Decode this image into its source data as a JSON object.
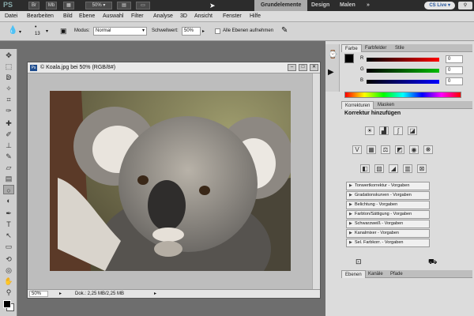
{
  "app": {
    "logo": "PS",
    "zoom_select": "50%",
    "workspaces": [
      "Grundelemente",
      "Design",
      "Malen"
    ],
    "more": "»",
    "cslive": "CS Live ▾"
  },
  "menu": [
    "Datei",
    "Bearbeiten",
    "Bild",
    "Ebene",
    "Auswahl",
    "Filter",
    "Analyse",
    "3D",
    "Ansicht",
    "Fenster",
    "Hilfe"
  ],
  "options": {
    "size": "13",
    "modus_label": "Modus:",
    "modus_value": "Normal",
    "schwell_label": "Schwellwert:",
    "schwell_value": "50%",
    "alle_label": "Alle Ebenen aufnehmen"
  },
  "document": {
    "title": "© Koala.jpg bei 50% (RGB/8#)",
    "zoom": "50%",
    "info": "Dok.: 2,25 MB/2,25 MB"
  },
  "color_panel": {
    "tabs": [
      "Farbe",
      "Farbfelder",
      "Stile"
    ],
    "sliders": [
      {
        "label": "R",
        "value": "0",
        "color": "#d82020"
      },
      {
        "label": "G",
        "value": "0",
        "color": "#20a020"
      },
      {
        "label": "B",
        "value": "0",
        "color": "#2030d0"
      }
    ]
  },
  "adjust_panel": {
    "tabs": [
      "Korrekturen",
      "Masken"
    ],
    "title": "Korrektur hinzufügen",
    "presets": [
      "Tonwertkorrektur - Vorgaben",
      "Gradationskurven - Vorgaben",
      "Belichtung - Vorgaben",
      "Farbton/Sättigung - Vorgaben",
      "Schwarzweiß - Vorgaben",
      "Kanalmixer - Vorgaben",
      "Sel. Farbkorr. - Vorgaben"
    ]
  },
  "layers_panel": {
    "tabs": [
      "Ebenen",
      "Kanäle",
      "Pfade"
    ]
  }
}
